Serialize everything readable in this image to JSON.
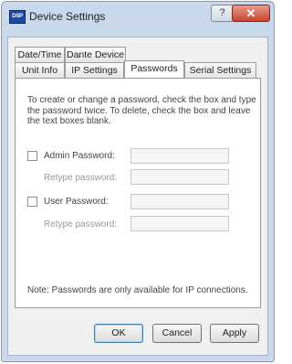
{
  "window": {
    "icon_text": "DSP",
    "title": "Device Settings",
    "help_glyph": "?",
    "close_glyph": "✕"
  },
  "tabs_row1": [
    {
      "label": "Date/Time"
    },
    {
      "label": "Dante Device"
    }
  ],
  "tabs_row2": [
    {
      "label": "Unit Info"
    },
    {
      "label": "IP Settings"
    },
    {
      "label": "Passwords",
      "active": true
    },
    {
      "label": "Serial Settings"
    }
  ],
  "passwords": {
    "description": "To create or change a password, check the box and type the password twice.  To delete, check the box and leave the text boxes blank.",
    "admin": {
      "checkbox_label": "Admin Password:",
      "retype_label": "Retype password:",
      "checked": false,
      "value": "",
      "retype_value": ""
    },
    "user": {
      "checkbox_label": "User Password:",
      "retype_label": "Retype password:",
      "checked": false,
      "value": "",
      "retype_value": ""
    },
    "note": "Note: Passwords are only available for IP connections."
  },
  "buttons": {
    "ok": "OK",
    "cancel": "Cancel",
    "apply": "Apply"
  }
}
